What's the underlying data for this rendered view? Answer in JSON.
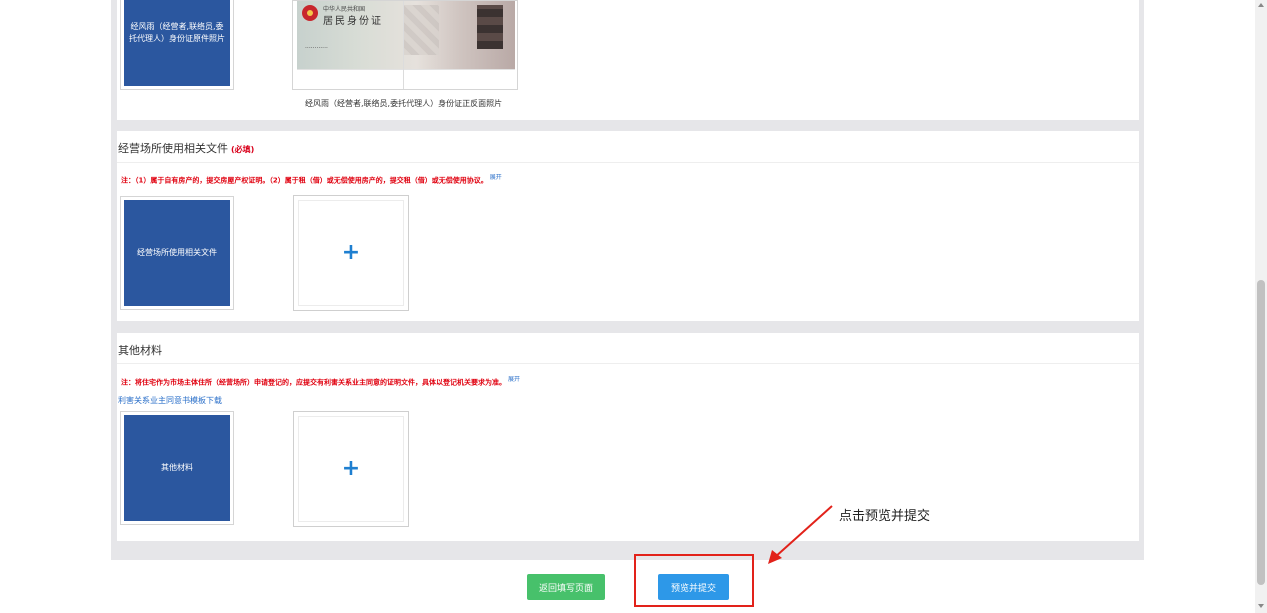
{
  "section_id": {
    "front_thumb_label": "经风雨（经营者,联络员,委托代理人）身份证原件照片",
    "idcard_line1": "中华人民共和国",
    "idcard_line2": "居民身份证",
    "caption": "经风雨（经营者,联络员,委托代理人）身份证正反面照片"
  },
  "section_premises": {
    "title": "经营场所使用相关文件",
    "required": "(必填)",
    "note": "注：（1）属于自有房产的，提交房屋产权证明。（2）属于租（借）或无偿使用房产的，提交租（借）或无偿使用协议。",
    "expand": "展开",
    "thumb_label": "经营场所使用相关文件",
    "upload_symbol": "+"
  },
  "section_other": {
    "title": "其他材料",
    "note": "注：将住宅作为市场主体住所（经营场所）申请登记的，应提交有利害关系业主同意的证明文件，具体以登记机关要求为准。",
    "expand": "展开",
    "link": "利害关系业主同意书模板下载",
    "thumb_label": "其他材料",
    "upload_symbol": "+"
  },
  "footer": {
    "back_button": "返回填写页面",
    "submit_button": "预览并提交",
    "annotation": "点击预览并提交"
  },
  "colors": {
    "thumb_blue": "#2b579f",
    "required_red": "#d9001b",
    "back_green": "#47c16b",
    "submit_blue": "#2d98e8",
    "highlight_red": "#e2221a",
    "link_blue": "#2a6fc9"
  }
}
